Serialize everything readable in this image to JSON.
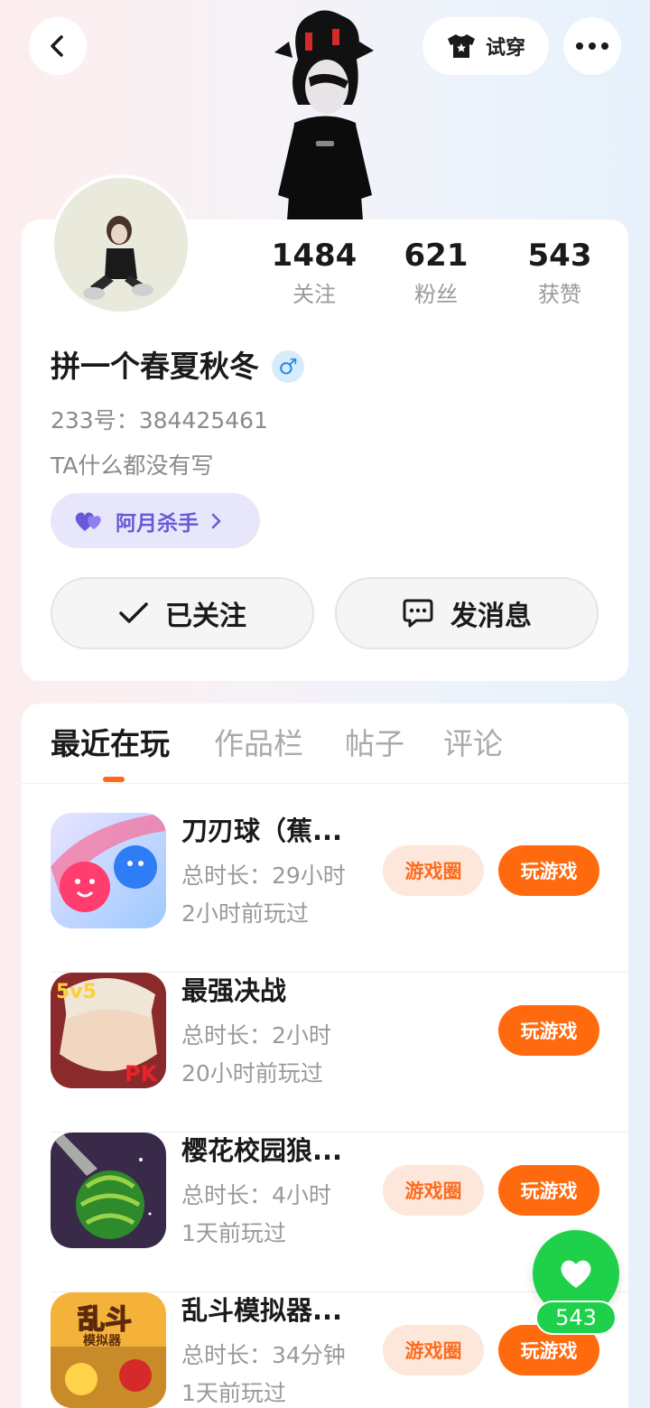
{
  "header": {
    "try_on_label": "试穿"
  },
  "profile": {
    "stats": [
      {
        "value": "1484",
        "label": "关注"
      },
      {
        "value": "621",
        "label": "粉丝"
      },
      {
        "value": "543",
        "label": "获赞"
      }
    ],
    "username": "拼一个春夏秋冬",
    "gender_symbol": "♂",
    "uid": "233号：384425461",
    "bio": "TA什么都没有写",
    "tag_label": "阿月杀手",
    "follow_label": "已关注",
    "message_label": "发消息"
  },
  "tabs": [
    "最近在玩",
    "作品栏",
    "帖子",
    "评论"
  ],
  "games": [
    {
      "name": "刀刃球（蕉...",
      "duration": "总时长：29小时",
      "last_played": "2小时前玩过",
      "circle_label": "游戏圈",
      "play_label": "玩游戏"
    },
    {
      "name": "最强决战",
      "duration": "总时长：2小时",
      "last_played": "20小时前玩过",
      "play_label": "玩游戏"
    },
    {
      "name": "樱花校园狼...",
      "duration": "总时长：4小时",
      "last_played": "1天前玩过",
      "circle_label": "游戏圈",
      "play_label": "玩游戏"
    },
    {
      "name": "乱斗模拟器...",
      "duration": "总时长：34分钟",
      "last_played": "1天前玩过",
      "circle_label": "游戏圈",
      "play_label": "玩游戏"
    }
  ],
  "game_icon_text": {
    "vs_badge": "5v5",
    "pk_badge": "PK",
    "brawl_title": "乱斗",
    "brawl_subtitle": "模拟器"
  },
  "like_fab": {
    "count": "543"
  }
}
